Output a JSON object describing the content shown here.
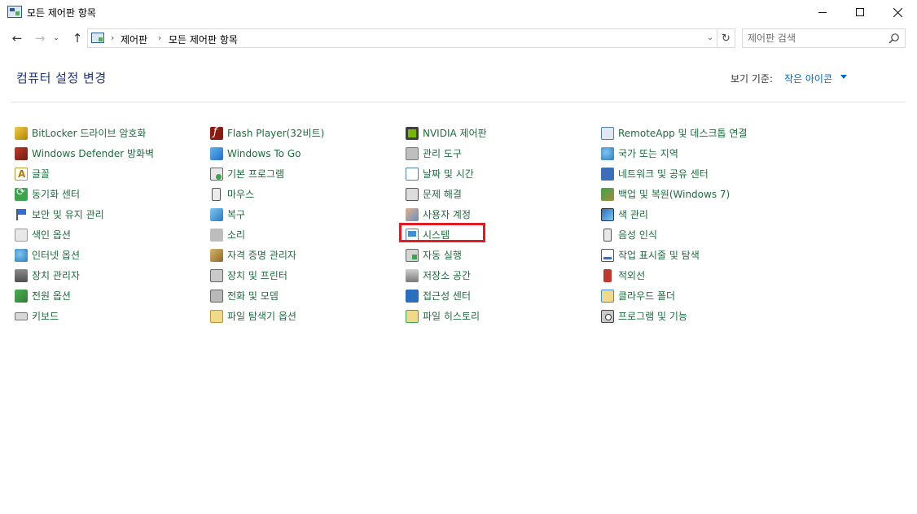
{
  "window": {
    "title": "모든 제어판 항목",
    "minimize_icon": "minimize-icon",
    "maximize_icon": "maximize-icon",
    "close_icon": "close-icon"
  },
  "nav": {
    "back_icon": "←",
    "forward_icon": "→",
    "recent_icon": "⌄",
    "up_icon": "↑",
    "breadcrumb": [
      "제어판",
      "모든 제어판 항목"
    ],
    "separator": "›",
    "dropdown_icon": "⌄",
    "refresh_icon": "↻"
  },
  "search": {
    "placeholder": "제어판 검색"
  },
  "header": {
    "title": "컴퓨터 설정 변경",
    "view_by_label": "보기 기준:",
    "view_by_value": "작은 아이콘"
  },
  "columns": [
    [
      {
        "label": "BitLocker 드라이브 암호화",
        "icon": "bitlocker-icon"
      },
      {
        "label": "Windows Defender 방화벽",
        "icon": "firewall-icon"
      },
      {
        "label": "글꼴",
        "icon": "fonts-icon"
      },
      {
        "label": "동기화 센터",
        "icon": "sync-center-icon"
      },
      {
        "label": "보안 및 유지 관리",
        "icon": "security-maintenance-icon"
      },
      {
        "label": "색인 옵션",
        "icon": "indexing-options-icon"
      },
      {
        "label": "인터넷 옵션",
        "icon": "internet-options-icon"
      },
      {
        "label": "장치 관리자",
        "icon": "device-manager-icon"
      },
      {
        "label": "전원 옵션",
        "icon": "power-options-icon"
      },
      {
        "label": "키보드",
        "icon": "keyboard-icon"
      }
    ],
    [
      {
        "label": "Flash Player(32비트)",
        "icon": "flash-player-icon"
      },
      {
        "label": "Windows To Go",
        "icon": "windows-to-go-icon"
      },
      {
        "label": "기본 프로그램",
        "icon": "default-programs-icon"
      },
      {
        "label": "마우스",
        "icon": "mouse-icon"
      },
      {
        "label": "복구",
        "icon": "recovery-icon"
      },
      {
        "label": "소리",
        "icon": "sound-icon"
      },
      {
        "label": "자격 증명 관리자",
        "icon": "credential-manager-icon"
      },
      {
        "label": "장치 및 프린터",
        "icon": "devices-printers-icon"
      },
      {
        "label": "전화 및 모뎀",
        "icon": "phone-modem-icon"
      },
      {
        "label": "파일 탐색기 옵션",
        "icon": "file-explorer-options-icon"
      }
    ],
    [
      {
        "label": "NVIDIA 제어판",
        "icon": "nvidia-control-panel-icon"
      },
      {
        "label": "관리 도구",
        "icon": "administrative-tools-icon"
      },
      {
        "label": "날짜 및 시간",
        "icon": "date-time-icon"
      },
      {
        "label": "문제 해결",
        "icon": "troubleshooting-icon"
      },
      {
        "label": "사용자 계정",
        "icon": "user-accounts-icon"
      },
      {
        "label": "시스템",
        "icon": "system-icon"
      },
      {
        "label": "자동 실행",
        "icon": "autoplay-icon"
      },
      {
        "label": "저장소 공간",
        "icon": "storage-spaces-icon"
      },
      {
        "label": "접근성 센터",
        "icon": "ease-of-access-icon"
      },
      {
        "label": "파일 히스토리",
        "icon": "file-history-icon"
      }
    ],
    [
      {
        "label": "RemoteApp 및 데스크톱 연결",
        "icon": "remoteapp-icon"
      },
      {
        "label": "국가 또는 지역",
        "icon": "region-icon"
      },
      {
        "label": "네트워크 및 공유 센터",
        "icon": "network-sharing-icon"
      },
      {
        "label": "백업 및 복원(Windows 7)",
        "icon": "backup-restore-icon"
      },
      {
        "label": "색 관리",
        "icon": "color-management-icon"
      },
      {
        "label": "음성 인식",
        "icon": "speech-recognition-icon"
      },
      {
        "label": "작업 표시줄 및 탐색",
        "icon": "taskbar-navigation-icon"
      },
      {
        "label": "적외선",
        "icon": "infrared-icon"
      },
      {
        "label": "클라우드 폴더",
        "icon": "work-folders-icon"
      },
      {
        "label": "프로그램 및 기능",
        "icon": "programs-features-icon"
      }
    ]
  ],
  "colors": {
    "title": "#1e3287",
    "link": "#1e6b3e",
    "accent": "#0066cc",
    "highlight": "#e11d23"
  },
  "highlighted_item": "시스템"
}
